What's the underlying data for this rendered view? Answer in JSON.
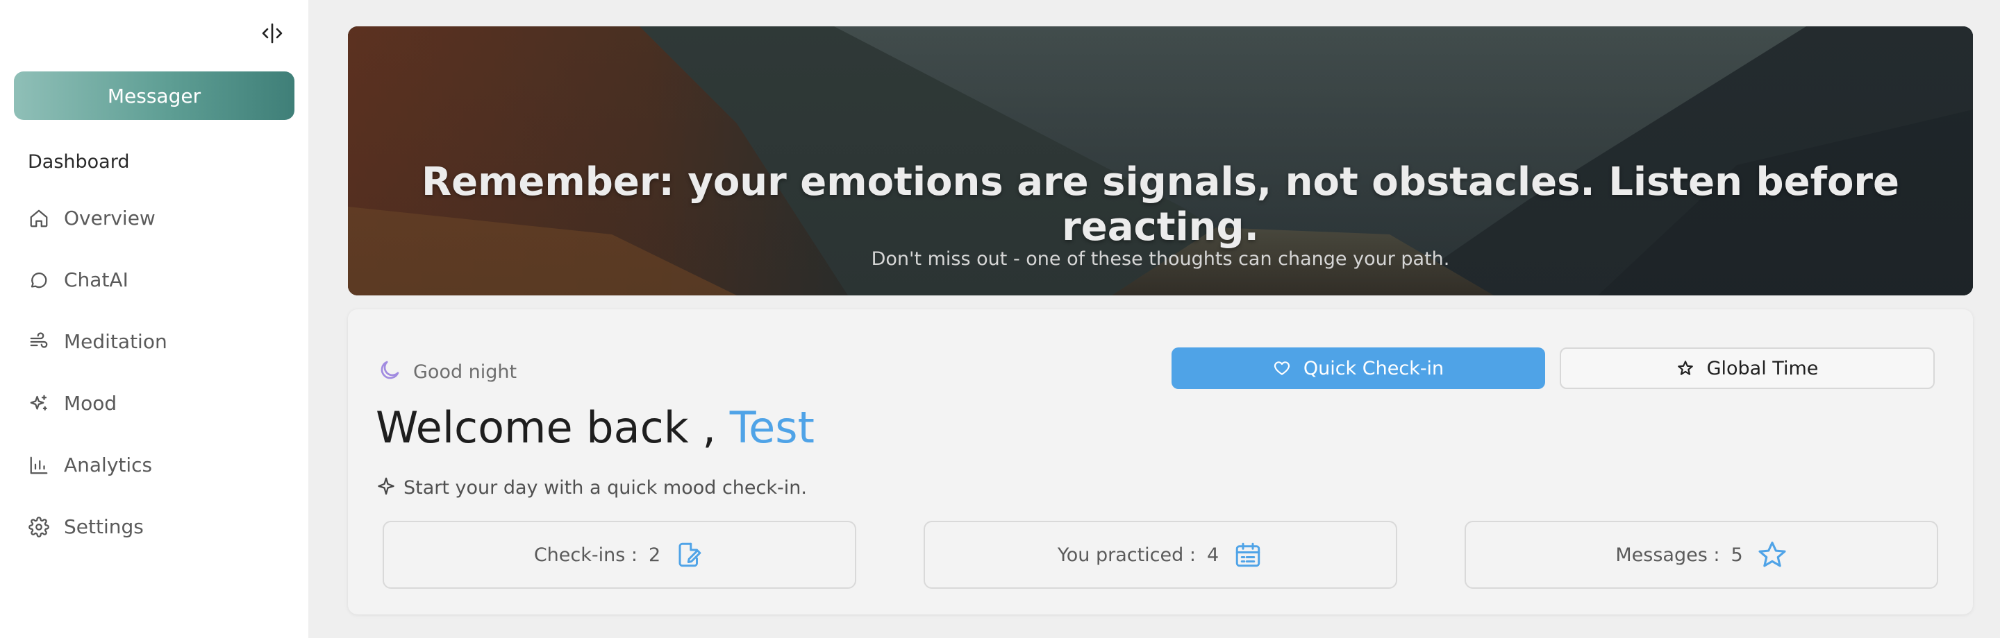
{
  "sidebar": {
    "toggle_icon": "sidebar-collapse-icon",
    "primary_button": "Messager",
    "section_label": "Dashboard",
    "items": [
      {
        "label": "Overview",
        "icon": "home-icon"
      },
      {
        "label": "ChatAI",
        "icon": "chat-bubble-icon"
      },
      {
        "label": "Meditation",
        "icon": "wind-icon"
      },
      {
        "label": "Mood",
        "icon": "sparkles-icon"
      },
      {
        "label": "Analytics",
        "icon": "bar-chart-icon"
      },
      {
        "label": "Settings",
        "icon": "gear-icon"
      }
    ]
  },
  "hero": {
    "quote": "Remember: your emotions are signals, not obstacles. Listen before reacting.",
    "subtitle": "Don't miss out - one of these thoughts can change your path."
  },
  "card": {
    "greeting": "Good night",
    "greeting_icon": "moon-icon",
    "quick_checkin_label": "Quick Check-in",
    "global_time_label": "Global Time",
    "welcome_prefix": "Welcome back ,",
    "user_name": "Test",
    "tagline": "Start your day with a quick mood check-in.",
    "stats": [
      {
        "label": "Check-ins :",
        "value": "2",
        "icon": "edit-note-icon"
      },
      {
        "label": "You practiced :",
        "value": "4",
        "icon": "calendar-icon"
      },
      {
        "label": "Messages :",
        "value": "5",
        "icon": "star-icon"
      }
    ]
  },
  "colors": {
    "accent": "#4fa3e7",
    "messager_gradient_start": "#8fbfb7",
    "messager_gradient_end": "#3f7f78",
    "moon": "#a18be0"
  }
}
